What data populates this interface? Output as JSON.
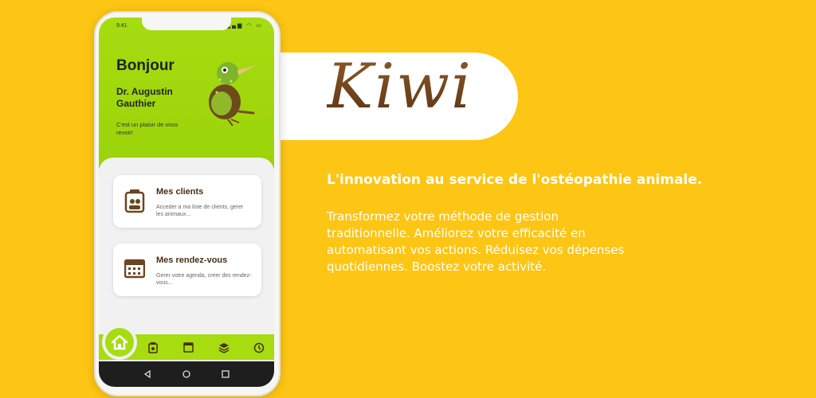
{
  "brand": {
    "name": "Kiwi",
    "tagline": "L'innovation au service de l'ostéopathie animale.",
    "description": "Transformez votre méthode de gestion traditionnelle. Améliorez votre efficacité en automatisant vos actions. Réduisez vos dépenses quotidiennes. Boostez votre activité."
  },
  "phone": {
    "status": {
      "time": "9:41",
      "icons": "wifi signal battery"
    },
    "header": {
      "greeting": "Bonjour",
      "doctor_name": "Dr. Augustin Gauthier",
      "welcome": "C'est un plaisir de vous revoir!"
    },
    "cards": [
      {
        "title": "Mes clients",
        "subtitle": "Acceder a ma liste de clients, gerer les animaux...",
        "icon": "clients-icon"
      },
      {
        "title": "Mes rendez-vous",
        "subtitle": "Gerer votre agenda, creer des rendez-vous...",
        "icon": "calendar-icon"
      }
    ],
    "bottom_nav": [
      "home-icon",
      "clients-icon",
      "calendar-icon",
      "layers-icon",
      "settings-icon"
    ],
    "system_nav": [
      "back-icon",
      "home-circle-icon",
      "recents-icon"
    ]
  },
  "colors": {
    "background": "#FDC514",
    "accent_green": "#A6DC10",
    "brown": "#7A4A1E"
  }
}
